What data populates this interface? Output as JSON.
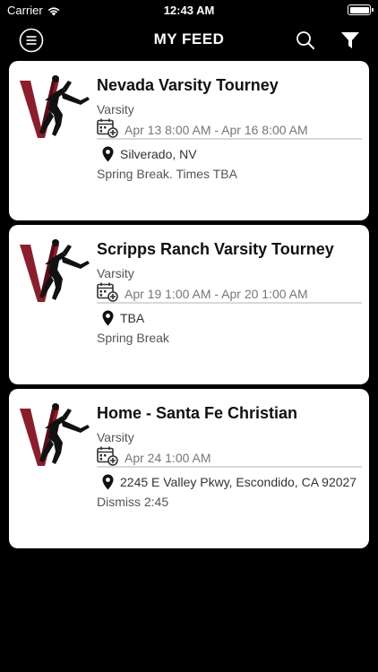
{
  "status_bar": {
    "carrier": "Carrier",
    "time": "12:43 AM"
  },
  "nav": {
    "title": "MY FEED",
    "menu_icon": "hamburger-circle-icon",
    "search_icon": "search-icon",
    "filter_icon": "filter-funnel-icon"
  },
  "events": [
    {
      "title": "Nevada Varsity Tourney",
      "level": "Varsity",
      "date": "Apr 13 8:00 AM - Apr 16 8:00 AM",
      "location": "Silverado, NV",
      "note": "Spring Break. Times TBA"
    },
    {
      "title": "Scripps Ranch Varsity Tourney",
      "level": "Varsity",
      "date": "Apr 19 1:00 AM - Apr 20 1:00 AM",
      "location": "TBA",
      "note": "Spring Break"
    },
    {
      "title": "Home - Santa Fe Christian",
      "level": "Varsity",
      "date": "Apr 24 1:00 AM",
      "location": "2245 E Valley Pkwy, Escondido, CA 92027",
      "note": "Dismiss 2:45"
    }
  ],
  "colors": {
    "background": "#000000",
    "card": "#ffffff",
    "logo_red": "#8b1e2d",
    "text": "#111111",
    "muted": "#777777"
  }
}
